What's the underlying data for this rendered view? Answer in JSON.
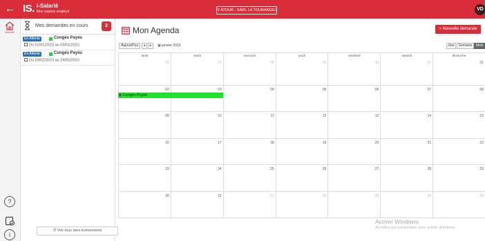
{
  "app": {
    "back_glyph": "←",
    "logo": "IS.",
    "title": "i-Salarié",
    "subtitle": "Mon espace employé",
    "company": "ATOUR - SARL LA TOURANGEL",
    "user_initials": "VD"
  },
  "rail": {
    "home_label": "Accueil",
    "help_glyph": "?",
    "info_glyph": "i"
  },
  "demandes": {
    "title": "Mes demandes en cours",
    "count": "2",
    "items": [
      {
        "status": "En Attente",
        "type": "Congés Payés",
        "dates": "Du 02/01/2023 au 03/01/2023"
      },
      {
        "status": "En Attente",
        "type": "Congés Payés",
        "dates": "Du 20/02/2023 au 24/02/2023"
      }
    ],
    "voir_tous": "Voir tous mes événements"
  },
  "agenda": {
    "title": "Mon Agenda",
    "new_button": "+ Nouvelle demande",
    "today": "Aujourd'hui",
    "prev": "◂",
    "next": "▸",
    "month": "janvier 2023",
    "views": {
      "jour": "Jour",
      "semaine": "Semaine",
      "mois": "Mois"
    },
    "weekdays": [
      "lundi",
      "mardi",
      "mercredi",
      "jeudi",
      "vendredi",
      "samedi",
      "dimanche"
    ],
    "weeks": [
      [
        "26",
        "27",
        "28",
        "29",
        "30",
        "31",
        "01"
      ],
      [
        "02",
        "03",
        "04",
        "05",
        "06",
        "07",
        "08"
      ],
      [
        "09",
        "10",
        "11",
        "12",
        "13",
        "14",
        "15"
      ],
      [
        "16",
        "17",
        "18",
        "19",
        "20",
        "21",
        "22"
      ],
      [
        "23",
        "24",
        "25",
        "26",
        "27",
        "28",
        "29"
      ],
      [
        "30",
        "31",
        "01",
        "02",
        "03",
        "04",
        "05"
      ]
    ],
    "event_label": "Congés Payés"
  },
  "watermark": {
    "line1": "Activer Windows",
    "line2": "Accédez aux paramètres pour activer Windows."
  },
  "colors": {
    "brand": "#d92e3a",
    "status_pending": "#2a72b5",
    "leave_event": "#22e22b"
  }
}
